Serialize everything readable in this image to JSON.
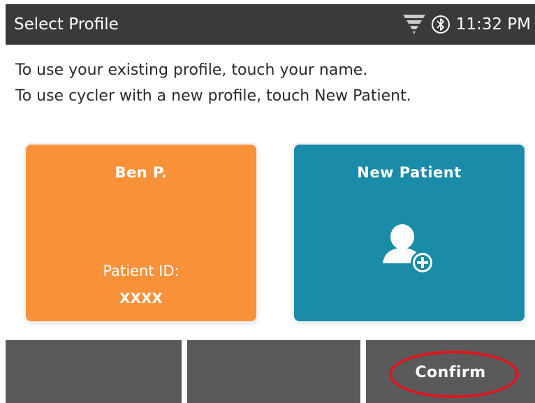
{
  "header": {
    "title": "Select Profile",
    "time": "11:32 PM",
    "wifi_icon": "wifi-signal-icon",
    "bluetooth_icon": "bluetooth-icon"
  },
  "instructions": {
    "line1": "To use your existing profile, touch your name.",
    "line2": "To use cycler with a new profile, touch New Patient."
  },
  "profiles": {
    "existing": {
      "name": "Ben P.",
      "id_label": "Patient ID:",
      "id_value": "XXXX",
      "color": "#f99139"
    },
    "new": {
      "label": "New Patient",
      "icon": "add-user-icon",
      "color": "#1a8ba8"
    }
  },
  "bottom_bar": {
    "confirm_label": "Confirm",
    "highlight_color": "#e0141c"
  }
}
